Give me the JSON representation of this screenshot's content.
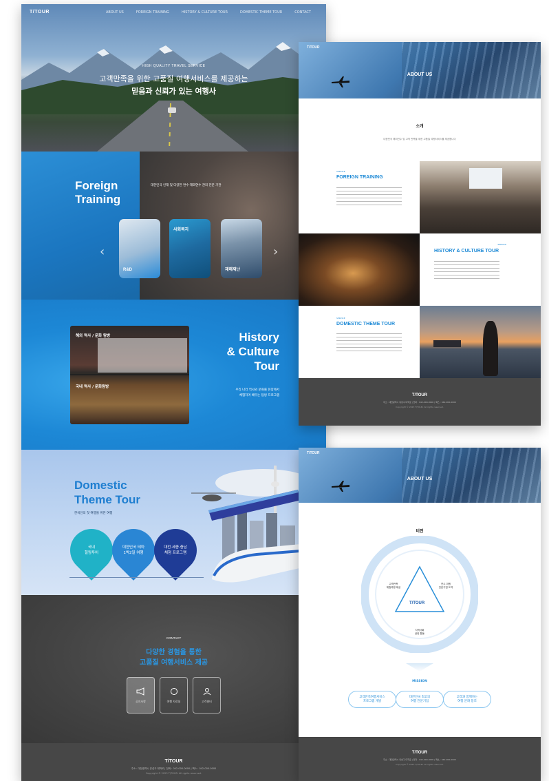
{
  "brand": {
    "logo": "T/TOUR"
  },
  "nav": {
    "items": [
      "ABOUT US",
      "FOREIGN TRAINING",
      "HISTORY & CULTURE TOUR",
      "DOMESTIC THEME TOUR",
      "CONTACT"
    ]
  },
  "hero": {
    "kicker": "HIGH QUALITY TRAVEL SERVICE",
    "line1": "고객만족을 위한 고품질 여행서비스를 제공하는",
    "line2": "믿음과 신뢰가 있는 여행사"
  },
  "foreign": {
    "title1": "Foreign",
    "title2": "Training",
    "desc": "대한민국 인재 및 다양한 연수·해외연수 관리 전문 기관",
    "cards": [
      {
        "label": "R&D"
      },
      {
        "label": "사회복지"
      },
      {
        "label": "재해재난"
      }
    ]
  },
  "history": {
    "title1": "History",
    "title2": "& Culture",
    "title3": "Tour",
    "box_label1": "해외 역사 / 문화 탐방",
    "box_label2": "국내 역사 / 문화탐방",
    "desc1": "우리 나라 역사와 문화를 현장에서",
    "desc2": "체험하며 배우는 탐방 프로그램"
  },
  "domestic": {
    "title1": "Domestic",
    "title2": "Theme Tour",
    "subtitle": "한국인의 첫 여행을 위한 여행",
    "pins": [
      "국내\n힐링투어",
      "대한민국 테마\n1박2일 여행",
      "대전·세종·충남\n체험 프로그램"
    ]
  },
  "contact": {
    "kicker": "CONTACT",
    "line1": "다양한 경험을 통한",
    "line2": "고품질 여행서비스 제공",
    "buttons": [
      "공지사항",
      "여행 자료실",
      "고객센터"
    ]
  },
  "footer": {
    "logo": "T/TOUR",
    "address": "주소 : 대전광역시 유성구 대학로 | 전화 : 042-000-0000 | 팩스 : 042-000-0000",
    "copyright": "Copyright © 2023 T/TOUR. All rights reserved."
  },
  "about": {
    "banner_title": "ABOUT US",
    "section_title": "소개",
    "intro": "대한민국 해외연수 및 고객 만족을 위한 고품질 여행서비스를 제공합니다",
    "blocks": [
      {
        "title": "FOREIGN TRAINING",
        "kicker": "SERVICE"
      },
      {
        "title": "HISTORY & CULTURE TOUR",
        "kicker": "SERVICE"
      },
      {
        "title": "DOMESTIC THEME TOUR",
        "kicker": "SERVICE"
      }
    ]
  },
  "vision": {
    "banner_title": "ABOUT US",
    "section_title": "비전",
    "mission_label": "MISSION",
    "center_logo": "T/TOUR",
    "nodes": [
      "고객만족\n체험여행 제공",
      "연수 여행\n전문기업 도약",
      "지역사회\n공헌 활동"
    ],
    "missions": [
      "고객만족여행서비스\n프로그램 개발",
      "대한민국 최고의\n여행 전문기업",
      "고객과 함께하는\n여행 문화 창조"
    ]
  },
  "colors": {
    "primary": "#1e8ad6",
    "dark": "#3a3a3a",
    "footer": "#444444"
  }
}
